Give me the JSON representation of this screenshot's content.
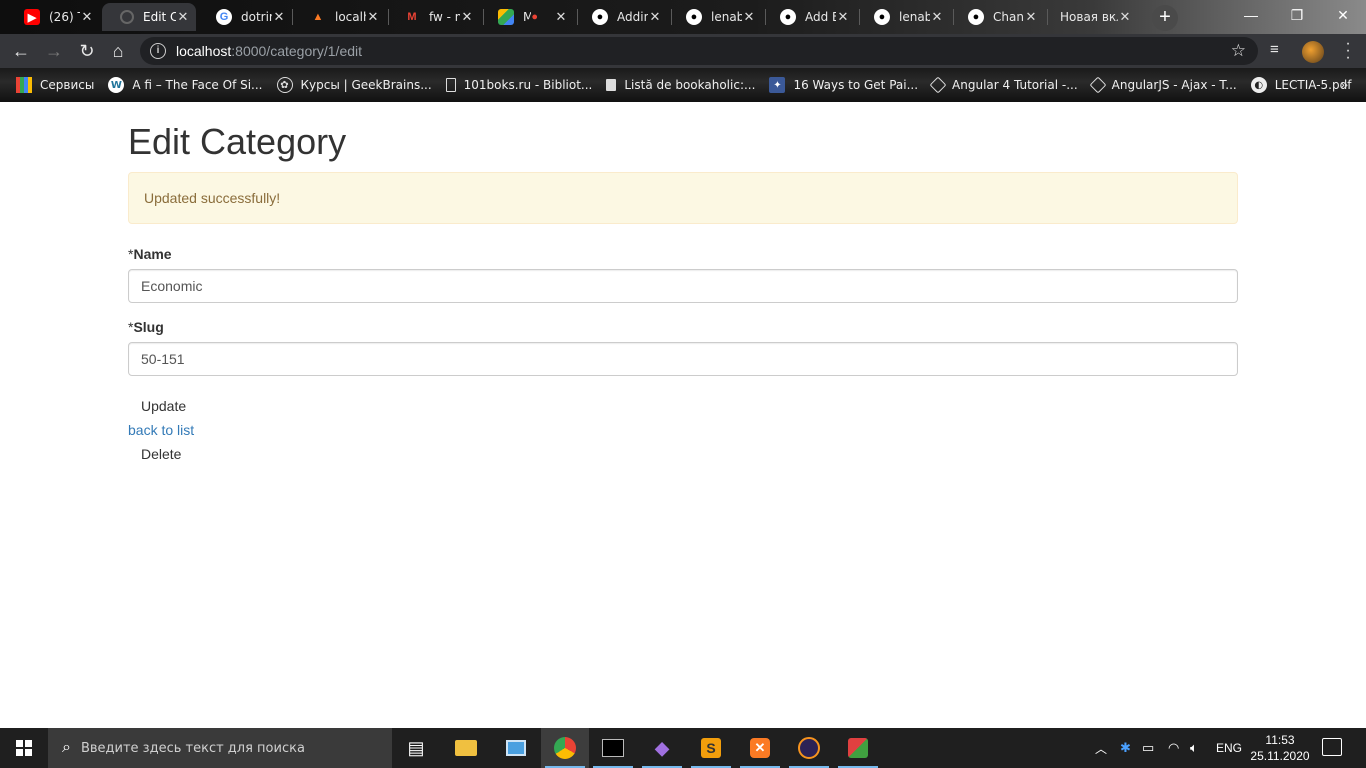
{
  "browser": {
    "tabs": [
      {
        "title": "(26) T",
        "icon": "youtube-icon",
        "color": "#ff0000"
      },
      {
        "title": "Edit C",
        "icon": "loading-icon",
        "color": "#888888"
      },
      {
        "title": "dotrin",
        "icon": "google-icon",
        "color": "#4285f4"
      },
      {
        "title": "localh",
        "icon": "xampp-icon",
        "color": "#fb7a24"
      },
      {
        "title": "fw - m",
        "icon": "gmail-icon",
        "color": "#ea4335"
      },
      {
        "title": "M",
        "icon": "drive-icon",
        "color": "#34a853"
      },
      {
        "title": "Addin",
        "icon": "github-icon",
        "color": "#ffffff"
      },
      {
        "title": "lenab",
        "icon": "github-icon",
        "color": "#ffffff"
      },
      {
        "title": "Add E",
        "icon": "github-icon",
        "color": "#ffffff"
      },
      {
        "title": "lenab",
        "icon": "github-icon",
        "color": "#ffffff"
      },
      {
        "title": "Chang",
        "icon": "github-icon",
        "color": "#ffffff"
      },
      {
        "title": "Новая вкл",
        "icon": "",
        "color": "#ffffff"
      }
    ],
    "active_tab_index": 1,
    "url_host": "localhost",
    "url_path": ":8000/category/1/edit"
  },
  "bookmarks": [
    {
      "label": "Сервисы",
      "icon": "apps-grid-icon"
    },
    {
      "label": "A fi – The Face Of Si...",
      "icon": "wordpress-icon"
    },
    {
      "label": "Курсы | GeekBrains...",
      "icon": "geekbrains-icon"
    },
    {
      "label": "101boks.ru - Bibliot...",
      "icon": "book-icon"
    },
    {
      "label": "Listă de bookaholic:...",
      "icon": "bookmark-icon"
    },
    {
      "label": "16 Ways to Get Pai...",
      "icon": "site-icon"
    },
    {
      "label": "Angular 4 Tutorial -...",
      "icon": "angular-icon"
    },
    {
      "label": "AngularJS - Ajax - T...",
      "icon": "angular-icon"
    },
    {
      "label": "LECTIA-5.pdf",
      "icon": "globe-icon"
    }
  ],
  "page": {
    "title": "Edit Category",
    "alert": "Updated successfully!",
    "name_required": "*",
    "name_label": "Name",
    "name_value": "Economic",
    "slug_required": "*",
    "slug_label": "Slug",
    "slug_value": "50-151",
    "update_label": "Update",
    "back_label": "back to list",
    "delete_label": "Delete"
  },
  "taskbar": {
    "search_placeholder": "Введите здесь текст для поиска",
    "language": "ENG",
    "time": "11:53",
    "date": "25.11.2020"
  }
}
